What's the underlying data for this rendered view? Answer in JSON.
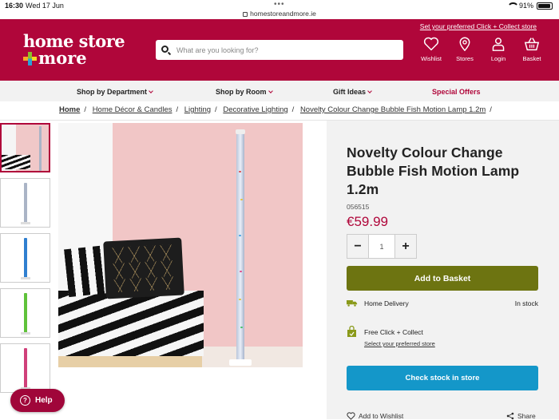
{
  "status_bar": {
    "time": "16:30",
    "date": "Wed 17 Jun",
    "url": "homestoreandmore.ie",
    "battery": "91%",
    "battery_level": 0.91
  },
  "header": {
    "logo_line1": "home store",
    "logo_line2": "more",
    "search_placeholder": "What are you looking for?",
    "preferred_store_link": "Set your preferred Click + Collect store",
    "icons": [
      {
        "label": "Wishlist",
        "icon": "heart-icon"
      },
      {
        "label": "Stores",
        "icon": "store-pin-icon"
      },
      {
        "label": "Login",
        "icon": "user-icon"
      },
      {
        "label": "Basket",
        "icon": "basket-icon"
      }
    ],
    "brand_color": "#b0063a"
  },
  "nav": {
    "items": [
      {
        "label": "Shop by Department"
      },
      {
        "label": "Shop by Room"
      },
      {
        "label": "Gift Ideas"
      },
      {
        "label": "Special Offers"
      }
    ]
  },
  "breadcrumb": [
    "Home",
    "Home Décor & Candles",
    "Lighting",
    "Decorative Lighting",
    "Novelty Colour Change Bubble Fish Motion Lamp 1.2m"
  ],
  "thumbnails": [
    {
      "variant": "room",
      "color": "#9aa6b8"
    },
    {
      "variant": "clear",
      "color": "#aab4c6"
    },
    {
      "variant": "blue",
      "color": "#2f7fd0"
    },
    {
      "variant": "green",
      "color": "#5fc23a"
    },
    {
      "variant": "pink",
      "color": "#d0407a"
    }
  ],
  "product": {
    "title": "Novelty Colour Change Bubble Fish Motion Lamp 1.2m",
    "sku": "056515",
    "price": "€59.99",
    "quantity": "1",
    "minus": "−",
    "plus": "+",
    "add_to_basket": "Add to Basket",
    "home_delivery": "Home Delivery",
    "in_stock": "In stock",
    "click_collect": "Free Click + Collect",
    "select_store": "Select your preferred store",
    "check_stock": "Check stock in store",
    "add_to_wishlist": "Add to Wishlist",
    "share": "Share"
  },
  "help_button": "Help",
  "colors": {
    "add_basket": "#6d7411",
    "check_stock": "#1497c9",
    "price": "#b0063a"
  }
}
